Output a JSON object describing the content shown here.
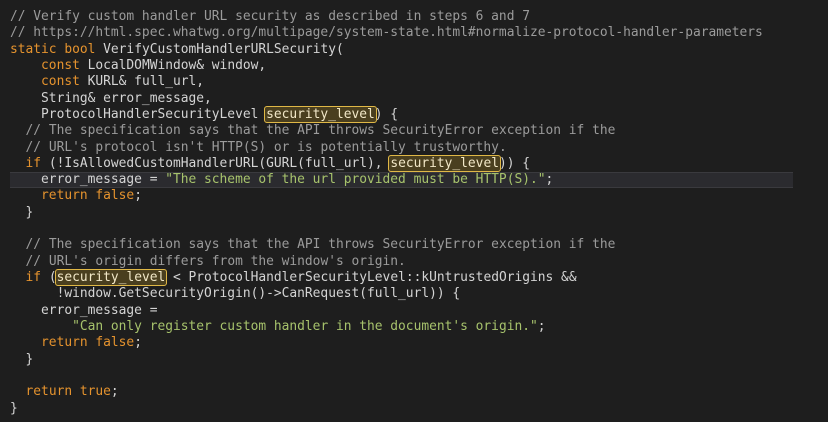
{
  "editor": {
    "highlight_term": "security_level",
    "current_line_index": 10,
    "colors": {
      "background": "#1e1e1e",
      "comment": "#9b9b9b",
      "keyword": "#e5932e",
      "string": "#a7c36c",
      "highlight_border": "#e0b846"
    },
    "lines": [
      [
        {
          "t": "c",
          "v": "// Verify custom handler URL security as described in steps 6 and 7"
        }
      ],
      [
        {
          "t": "c",
          "v": "// https://html.spec.whatwg.org/multipage/system-state.html#normalize-protocol-handler-parameters"
        }
      ],
      [
        {
          "t": "k",
          "v": "static"
        },
        {
          "t": "p",
          "v": " "
        },
        {
          "t": "k",
          "v": "bool"
        },
        {
          "t": "p",
          "v": " VerifyCustomHandlerURLSecurity("
        }
      ],
      [
        {
          "t": "p",
          "v": "    "
        },
        {
          "t": "k",
          "v": "const"
        },
        {
          "t": "p",
          "v": " LocalDOMWindow& window,"
        }
      ],
      [
        {
          "t": "p",
          "v": "    "
        },
        {
          "t": "k",
          "v": "const"
        },
        {
          "t": "p",
          "v": " KURL& full_url,"
        }
      ],
      [
        {
          "t": "p",
          "v": "    String& error_message,"
        }
      ],
      [
        {
          "t": "p",
          "v": "    ProtocolHandlerSecurityLevel "
        },
        {
          "t": "h",
          "v": "security_level"
        },
        {
          "t": "p",
          "v": ") {"
        }
      ],
      [
        {
          "t": "p",
          "v": "  "
        },
        {
          "t": "c",
          "v": "// The specification says that the API throws SecurityError exception if the"
        }
      ],
      [
        {
          "t": "p",
          "v": "  "
        },
        {
          "t": "c",
          "v": "// URL's protocol isn't HTTP(S) or is potentially trustworthy."
        }
      ],
      [
        {
          "t": "p",
          "v": "  "
        },
        {
          "t": "k",
          "v": "if"
        },
        {
          "t": "p",
          "v": " (!IsAllowedCustomHandlerURL(GURL(full_url), "
        },
        {
          "t": "h",
          "v": "security_level"
        },
        {
          "t": "p",
          "v": ")) {"
        }
      ],
      [
        {
          "t": "p",
          "v": "    error_message = "
        },
        {
          "t": "s",
          "v": "\"The scheme of the url provided must be HTTP(S).\""
        },
        {
          "t": "p",
          "v": ";"
        }
      ],
      [
        {
          "t": "p",
          "v": "    "
        },
        {
          "t": "k",
          "v": "return"
        },
        {
          "t": "p",
          "v": " "
        },
        {
          "t": "k",
          "v": "false"
        },
        {
          "t": "p",
          "v": ";"
        }
      ],
      [
        {
          "t": "p",
          "v": "  }"
        }
      ],
      [],
      [
        {
          "t": "p",
          "v": "  "
        },
        {
          "t": "c",
          "v": "// The specification says that the API throws SecurityError exception if the"
        }
      ],
      [
        {
          "t": "p",
          "v": "  "
        },
        {
          "t": "c",
          "v": "// URL's origin differs from the window's origin."
        }
      ],
      [
        {
          "t": "p",
          "v": "  "
        },
        {
          "t": "k",
          "v": "if"
        },
        {
          "t": "p",
          "v": " ("
        },
        {
          "t": "h",
          "v": "security_level"
        },
        {
          "t": "p",
          "v": " < ProtocolHandlerSecurityLevel::kUntrustedOrigins &&"
        }
      ],
      [
        {
          "t": "p",
          "v": "      !window.GetSecurityOrigin()->CanRequest(full_url)) {"
        }
      ],
      [
        {
          "t": "p",
          "v": "    error_message ="
        }
      ],
      [
        {
          "t": "p",
          "v": "        "
        },
        {
          "t": "s",
          "v": "\"Can only register custom handler in the document's origin.\""
        },
        {
          "t": "p",
          "v": ";"
        }
      ],
      [
        {
          "t": "p",
          "v": "    "
        },
        {
          "t": "k",
          "v": "return"
        },
        {
          "t": "p",
          "v": " "
        },
        {
          "t": "k",
          "v": "false"
        },
        {
          "t": "p",
          "v": ";"
        }
      ],
      [
        {
          "t": "p",
          "v": "  }"
        }
      ],
      [],
      [
        {
          "t": "p",
          "v": "  "
        },
        {
          "t": "k",
          "v": "return"
        },
        {
          "t": "p",
          "v": " "
        },
        {
          "t": "k",
          "v": "true"
        },
        {
          "t": "p",
          "v": ";"
        }
      ],
      [
        {
          "t": "p",
          "v": "}"
        }
      ]
    ]
  }
}
